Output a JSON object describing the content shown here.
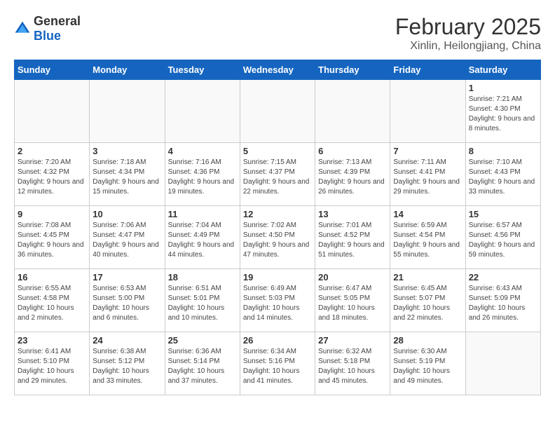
{
  "app": {
    "logo_general": "General",
    "logo_blue": "Blue"
  },
  "title": "February 2025",
  "subtitle": "Xinlin, Heilongjiang, China",
  "headers": [
    "Sunday",
    "Monday",
    "Tuesday",
    "Wednesday",
    "Thursday",
    "Friday",
    "Saturday"
  ],
  "days": [
    {
      "num": "",
      "info": ""
    },
    {
      "num": "",
      "info": ""
    },
    {
      "num": "",
      "info": ""
    },
    {
      "num": "",
      "info": ""
    },
    {
      "num": "",
      "info": ""
    },
    {
      "num": "",
      "info": ""
    },
    {
      "num": "1",
      "info": "Sunrise: 7:21 AM\nSunset: 4:30 PM\nDaylight: 9 hours and 8 minutes."
    }
  ],
  "week2": [
    {
      "num": "2",
      "info": "Sunrise: 7:20 AM\nSunset: 4:32 PM\nDaylight: 9 hours and 12 minutes."
    },
    {
      "num": "3",
      "info": "Sunrise: 7:18 AM\nSunset: 4:34 PM\nDaylight: 9 hours and 15 minutes."
    },
    {
      "num": "4",
      "info": "Sunrise: 7:16 AM\nSunset: 4:36 PM\nDaylight: 9 hours and 19 minutes."
    },
    {
      "num": "5",
      "info": "Sunrise: 7:15 AM\nSunset: 4:37 PM\nDaylight: 9 hours and 22 minutes."
    },
    {
      "num": "6",
      "info": "Sunrise: 7:13 AM\nSunset: 4:39 PM\nDaylight: 9 hours and 26 minutes."
    },
    {
      "num": "7",
      "info": "Sunrise: 7:11 AM\nSunset: 4:41 PM\nDaylight: 9 hours and 29 minutes."
    },
    {
      "num": "8",
      "info": "Sunrise: 7:10 AM\nSunset: 4:43 PM\nDaylight: 9 hours and 33 minutes."
    }
  ],
  "week3": [
    {
      "num": "9",
      "info": "Sunrise: 7:08 AM\nSunset: 4:45 PM\nDaylight: 9 hours and 36 minutes."
    },
    {
      "num": "10",
      "info": "Sunrise: 7:06 AM\nSunset: 4:47 PM\nDaylight: 9 hours and 40 minutes."
    },
    {
      "num": "11",
      "info": "Sunrise: 7:04 AM\nSunset: 4:49 PM\nDaylight: 9 hours and 44 minutes."
    },
    {
      "num": "12",
      "info": "Sunrise: 7:02 AM\nSunset: 4:50 PM\nDaylight: 9 hours and 47 minutes."
    },
    {
      "num": "13",
      "info": "Sunrise: 7:01 AM\nSunset: 4:52 PM\nDaylight: 9 hours and 51 minutes."
    },
    {
      "num": "14",
      "info": "Sunrise: 6:59 AM\nSunset: 4:54 PM\nDaylight: 9 hours and 55 minutes."
    },
    {
      "num": "15",
      "info": "Sunrise: 6:57 AM\nSunset: 4:56 PM\nDaylight: 9 hours and 59 minutes."
    }
  ],
  "week4": [
    {
      "num": "16",
      "info": "Sunrise: 6:55 AM\nSunset: 4:58 PM\nDaylight: 10 hours and 2 minutes."
    },
    {
      "num": "17",
      "info": "Sunrise: 6:53 AM\nSunset: 5:00 PM\nDaylight: 10 hours and 6 minutes."
    },
    {
      "num": "18",
      "info": "Sunrise: 6:51 AM\nSunset: 5:01 PM\nDaylight: 10 hours and 10 minutes."
    },
    {
      "num": "19",
      "info": "Sunrise: 6:49 AM\nSunset: 5:03 PM\nDaylight: 10 hours and 14 minutes."
    },
    {
      "num": "20",
      "info": "Sunrise: 6:47 AM\nSunset: 5:05 PM\nDaylight: 10 hours and 18 minutes."
    },
    {
      "num": "21",
      "info": "Sunrise: 6:45 AM\nSunset: 5:07 PM\nDaylight: 10 hours and 22 minutes."
    },
    {
      "num": "22",
      "info": "Sunrise: 6:43 AM\nSunset: 5:09 PM\nDaylight: 10 hours and 26 minutes."
    }
  ],
  "week5": [
    {
      "num": "23",
      "info": "Sunrise: 6:41 AM\nSunset: 5:10 PM\nDaylight: 10 hours and 29 minutes."
    },
    {
      "num": "24",
      "info": "Sunrise: 6:38 AM\nSunset: 5:12 PM\nDaylight: 10 hours and 33 minutes."
    },
    {
      "num": "25",
      "info": "Sunrise: 6:36 AM\nSunset: 5:14 PM\nDaylight: 10 hours and 37 minutes."
    },
    {
      "num": "26",
      "info": "Sunrise: 6:34 AM\nSunset: 5:16 PM\nDaylight: 10 hours and 41 minutes."
    },
    {
      "num": "27",
      "info": "Sunrise: 6:32 AM\nSunset: 5:18 PM\nDaylight: 10 hours and 45 minutes."
    },
    {
      "num": "28",
      "info": "Sunrise: 6:30 AM\nSunset: 5:19 PM\nDaylight: 10 hours and 49 minutes."
    },
    {
      "num": "",
      "info": ""
    }
  ]
}
